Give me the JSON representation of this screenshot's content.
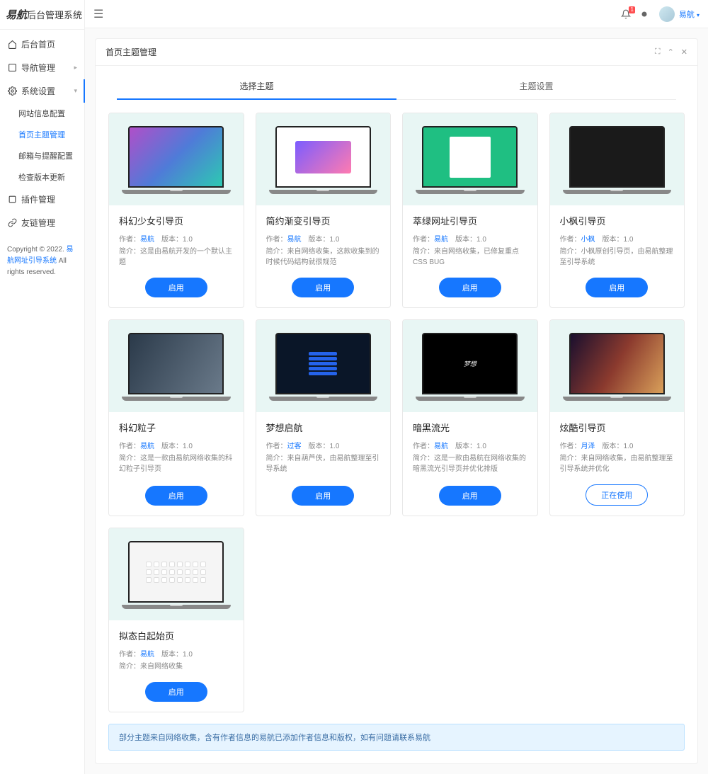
{
  "logo": {
    "bold": "易航",
    "rest": "后台管理系统"
  },
  "nav": {
    "items": [
      {
        "label": "后台首页"
      },
      {
        "label": "导航管理"
      },
      {
        "label": "系统设置"
      },
      {
        "label": "插件管理"
      },
      {
        "label": "友链管理"
      }
    ],
    "sub": [
      {
        "label": "网站信息配置"
      },
      {
        "label": "首页主题管理"
      },
      {
        "label": "邮箱与提醒配置"
      },
      {
        "label": "检查版本更新"
      }
    ]
  },
  "copyright": {
    "prefix": "Copyright © 2022. ",
    "link": "易航网址引导系统",
    "suffix": " All rights reserved."
  },
  "topbar": {
    "badge": "1",
    "username": "易航"
  },
  "panel": {
    "title": "首页主题管理",
    "tabs": [
      "选择主题",
      "主题设置"
    ]
  },
  "authorLabel": "作者：",
  "versionLabel": "版本：",
  "descLabel": "简介：",
  "btn": {
    "enable": "启用",
    "using": "正在使用"
  },
  "themes": [
    {
      "title": "科幻少女引导页",
      "author": "易航",
      "version": "1.0",
      "desc": "这是由易航开发的一个默认主题",
      "state": "enable",
      "sc": "sc1"
    },
    {
      "title": "简约渐变引导页",
      "author": "易航",
      "version": "1.0",
      "desc": "来自网络收集，这款收集到的时候代码结构就很规范",
      "state": "enable",
      "sc": "sc2"
    },
    {
      "title": "萃绿网址引导页",
      "author": "易航",
      "version": "1.0",
      "desc": "来自网络收集，已修复重点CSS BUG",
      "state": "enable",
      "sc": "sc3"
    },
    {
      "title": "小枫引导页",
      "author": "小枫",
      "version": "1.0",
      "desc": "小枫原创引导页，由易航整理至引导系统",
      "state": "enable",
      "sc": "sc4"
    },
    {
      "title": "科幻粒子",
      "author": "易航",
      "version": "1.0",
      "desc": "这是一款由易航网络收集的科幻粒子引导页",
      "state": "enable",
      "sc": "sc5"
    },
    {
      "title": "梦想启航",
      "author": "过客",
      "version": "1.0",
      "desc": "来自葫芦侠，由易航整理至引导系统",
      "state": "enable",
      "sc": "sc6"
    },
    {
      "title": "暗黑流光",
      "author": "易航",
      "version": "1.0",
      "desc": "这是一款由易航在网络收集的暗黑流光引导页并优化排版",
      "state": "enable",
      "sc": "sc7"
    },
    {
      "title": "炫酷引导页",
      "author": "月泽",
      "version": "1.0",
      "desc": "来自网络收集，由易航整理至引导系统并优化",
      "state": "using",
      "sc": "sc8"
    },
    {
      "title": "拟态白起始页",
      "author": "易航",
      "version": "1.0",
      "desc": "来自网络收集",
      "state": "enable",
      "sc": "sc9"
    }
  ],
  "alert": "部分主题来自网络收集，含有作者信息的易航已添加作者信息和版权，如有问题请联系易航"
}
